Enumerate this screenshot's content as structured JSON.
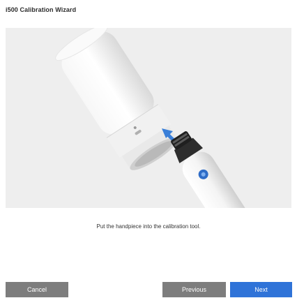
{
  "window": {
    "title": "i500 Calibration Wizard"
  },
  "illustration": {
    "icon": "handpiece-into-calibration-tool-illustration",
    "background_color": "#eeeeee",
    "arrow_color": "#3a7fd8"
  },
  "instruction": {
    "text": "Put the handpiece into the calibration tool."
  },
  "buttons": {
    "cancel_label": "Cancel",
    "previous_label": "Previous",
    "next_label": "Next"
  },
  "colors": {
    "secondary_button": "#7d7d7d",
    "primary_button": "#2f73d8"
  }
}
